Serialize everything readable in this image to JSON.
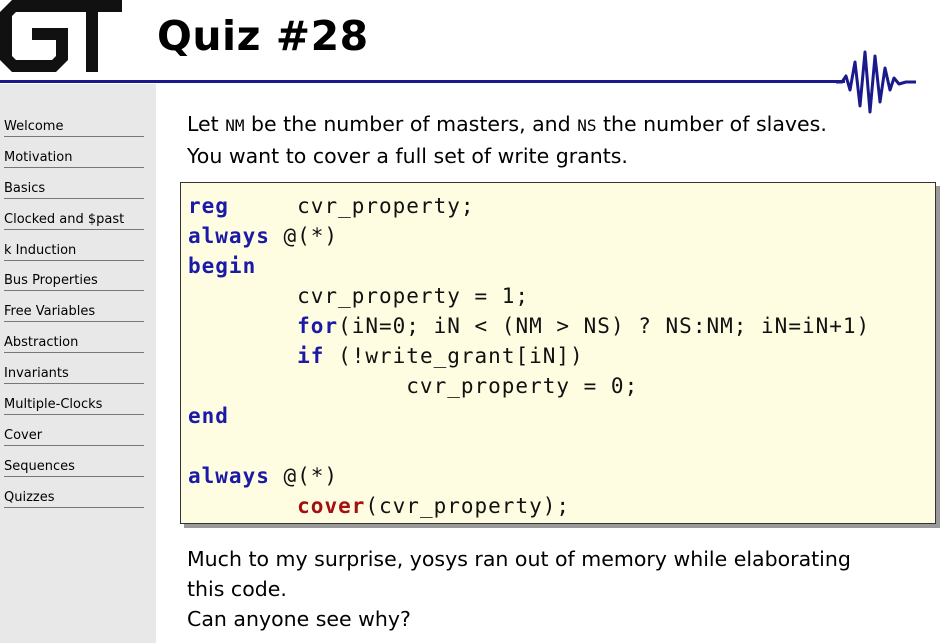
{
  "header": {
    "logo_text": "GT",
    "title": "Quiz #28"
  },
  "sidebar": {
    "items": [
      {
        "label": "Welcome"
      },
      {
        "label": "Motivation"
      },
      {
        "label": "Basics"
      },
      {
        "label": "Clocked and $past"
      },
      {
        "label": "k Induction"
      },
      {
        "label": "Bus Properties"
      },
      {
        "label": "Free Variables"
      },
      {
        "label": "Abstraction"
      },
      {
        "label": "Invariants"
      },
      {
        "label": "Multiple-Clocks"
      },
      {
        "label": "Cover"
      },
      {
        "label": "Sequences"
      },
      {
        "label": "Quizzes"
      }
    ]
  },
  "content": {
    "intro": {
      "t1": "Let ",
      "nm": "NM",
      "t2": " be the number of masters, and ",
      "ns": "NS",
      "t3": " the number of slaves.",
      "line2": "You want to cover a full set of write grants."
    },
    "code": {
      "kw_reg": "reg",
      "l1_rest": "     cvr_property;",
      "kw_always1": "always",
      "l2_rest": " @(*)",
      "kw_begin": "begin",
      "l4": "        cvr_property = 1;",
      "l5_indent": "        ",
      "kw_for": "for",
      "l5_rest": "(iN=0; iN < (NM > NS) ? NS:NM; iN=iN+1)",
      "l6_indent": "        ",
      "kw_if": "if",
      "l6_rest": " (!write_grant[iN])",
      "l7": "                cvr_property = 0;",
      "kw_end": "end",
      "kw_always2": "always",
      "l10_rest": " @(*)",
      "l11_indent": "        ",
      "kw_cover": "cover",
      "l11_rest": "(cvr_property);"
    },
    "outro": {
      "line1": "Much to my surprise, yosys ran out of memory while elaborating",
      "line2": "this code.",
      "line3": "Can anyone see why?"
    }
  },
  "colors": {
    "title_rule": "#1a1a8c",
    "sidebar_bg": "#e8e8e8",
    "code_bg": "#fffde1",
    "keyword": "#1a1aa6",
    "cover_keyword": "#a21010"
  }
}
